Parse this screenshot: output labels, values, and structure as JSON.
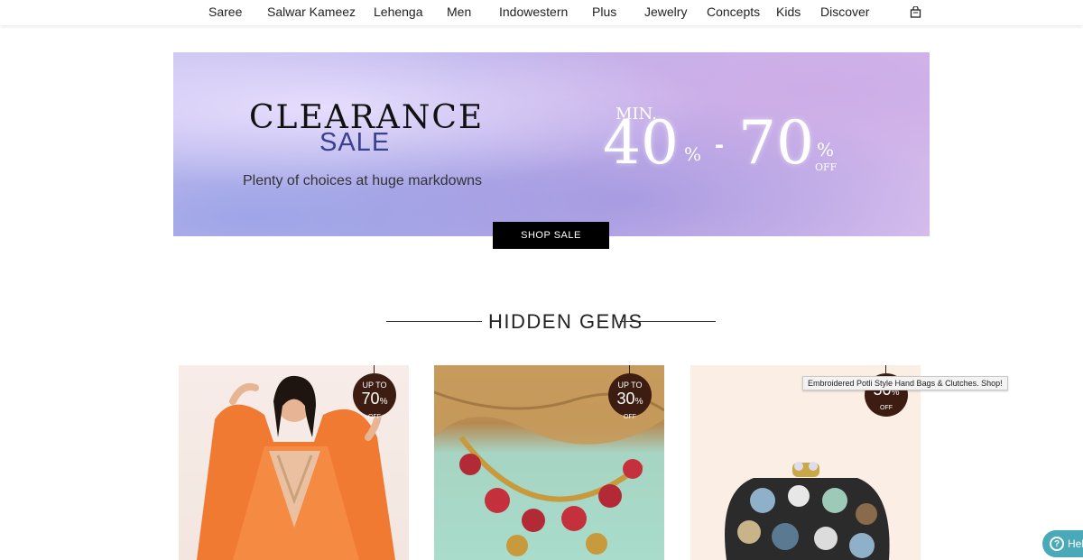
{
  "nav": {
    "items": [
      {
        "label": "Saree"
      },
      {
        "label": "Salwar Kameez"
      },
      {
        "label": "Lehenga"
      },
      {
        "label": "Men"
      },
      {
        "label": "Indowestern"
      },
      {
        "label": "Plus"
      },
      {
        "label": "Jewelry"
      },
      {
        "label": "Concepts"
      },
      {
        "label": "Kids"
      },
      {
        "label": "Discover"
      }
    ],
    "cart_icon": "shopping-bag-icon"
  },
  "banner": {
    "title": "CLEARANCE",
    "subtitle": "SALE",
    "tagline": "Plenty of choices at huge markdowns",
    "min_label": "MIN.",
    "discount_low": "40",
    "discount_high": "70",
    "percent": "%",
    "dash": "-",
    "off": "OFF",
    "cta": "SHOP SALE"
  },
  "section": {
    "title": "HIDDEN GEMS"
  },
  "products": [
    {
      "badge_top": "UP TO",
      "badge_value": "70",
      "badge_pct": "%",
      "badge_off": "OFF"
    },
    {
      "badge_top": "UP TO",
      "badge_value": "30",
      "badge_pct": "%",
      "badge_off": "OFF"
    },
    {
      "badge_top": "",
      "badge_value": "50",
      "badge_pct": "%",
      "badge_off": "OFF"
    }
  ],
  "tooltip": "Embroidered Potli Style Hand Bags & Clutches. Shop!",
  "help": {
    "label": "Help",
    "icon": "question-circle-icon"
  },
  "colors": {
    "badge": "#3d1c12",
    "help": "#4aa9b8",
    "cta": "#000000"
  }
}
